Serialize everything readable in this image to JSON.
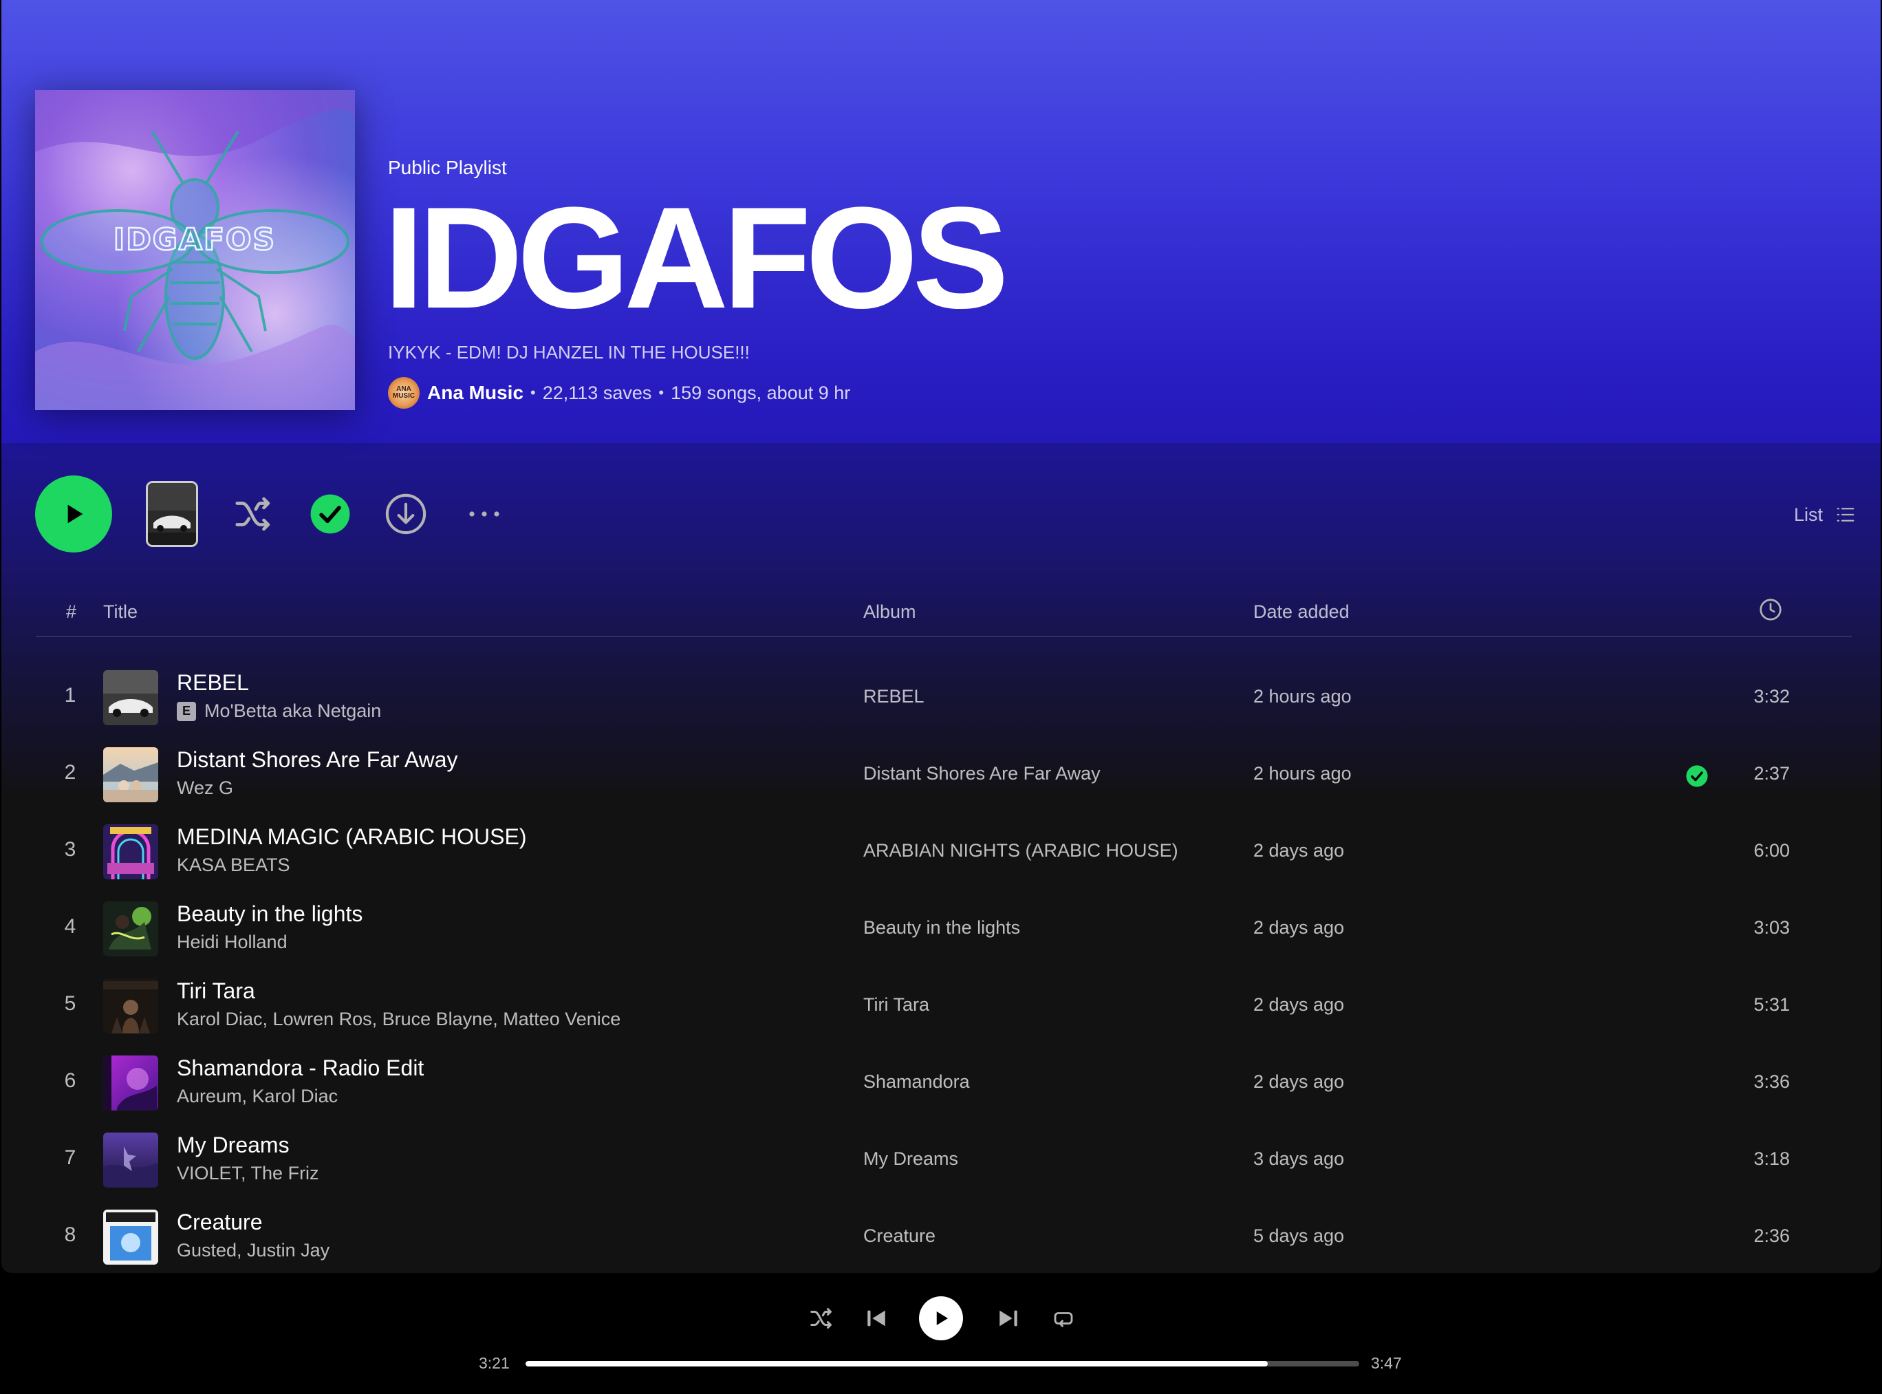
{
  "playlist": {
    "type_label": "Public Playlist",
    "title": "IDGAFOS",
    "cover_text": "IDGAFOS",
    "description": "IYKYK - EDM! DJ HANZEL IN THE HOUSE!!!",
    "owner": "Ana Music",
    "owner_avatar_text": "ANA MUSIC",
    "saves": "22,113 saves",
    "songs_duration": "159 songs, about 9 hr",
    "separator": "•"
  },
  "actions": {
    "view_label": "List",
    "icons": [
      "play-icon",
      "shuffle-icon",
      "check-icon",
      "download-icon",
      "more-icon",
      "list-icon"
    ]
  },
  "table": {
    "headers": {
      "number": "#",
      "title": "Title",
      "album": "Album",
      "date_added": "Date added",
      "duration_icon": "clock-icon"
    },
    "rows": [
      {
        "num": "1",
        "title": "REBEL",
        "explicit": true,
        "explicit_label": "E",
        "artist": "Mo'Betta aka Netgain",
        "album": "REBEL",
        "date": "2 hours ago",
        "saved": false,
        "duration": "3:32"
      },
      {
        "num": "2",
        "title": "Distant Shores Are Far Away",
        "explicit": false,
        "artist": "Wez G",
        "album": "Distant Shores Are Far Away",
        "date": "2 hours ago",
        "saved": true,
        "duration": "2:37"
      },
      {
        "num": "3",
        "title": "MEDINA MAGIC (ARABIC HOUSE)",
        "explicit": false,
        "artist": "KASA BEATS",
        "album": "ARABIAN NIGHTS (ARABIC HOUSE)",
        "date": "2 days ago",
        "saved": false,
        "duration": "6:00"
      },
      {
        "num": "4",
        "title": "Beauty in the lights",
        "explicit": false,
        "artist": "Heidi Holland",
        "album": "Beauty in the lights",
        "date": "2 days ago",
        "saved": false,
        "duration": "3:03"
      },
      {
        "num": "5",
        "title": "Tiri Tara",
        "explicit": false,
        "artist": "Karol Diac, Lowren Ros, Bruce Blayne, Matteo Venice",
        "album": "Tiri Tara",
        "date": "2 days ago",
        "saved": false,
        "duration": "5:31"
      },
      {
        "num": "6",
        "title": "Shamandora - Radio Edit",
        "explicit": false,
        "artist": "Aureum, Karol Diac",
        "album": "Shamandora",
        "date": "2 days ago",
        "saved": false,
        "duration": "3:36"
      },
      {
        "num": "7",
        "title": "My Dreams",
        "explicit": false,
        "artist": "VIOLET, The Friz",
        "album": "My Dreams",
        "date": "3 days ago",
        "saved": false,
        "duration": "3:18"
      },
      {
        "num": "8",
        "title": "Creature",
        "explicit": false,
        "artist": "Gusted, Justin Jay",
        "album": "Creature",
        "date": "5 days ago",
        "saved": false,
        "duration": "2:36"
      }
    ]
  },
  "player": {
    "elapsed": "3:21",
    "total": "3:47",
    "progress_fraction": 0.89,
    "icons": [
      "shuffle-icon",
      "previous-icon",
      "play-icon",
      "next-icon",
      "repeat-icon"
    ]
  },
  "colors": {
    "accent_green": "#1ed760",
    "hero_top": "#4f53e6",
    "hero_bottom": "#2418b8",
    "background": "#121212"
  }
}
